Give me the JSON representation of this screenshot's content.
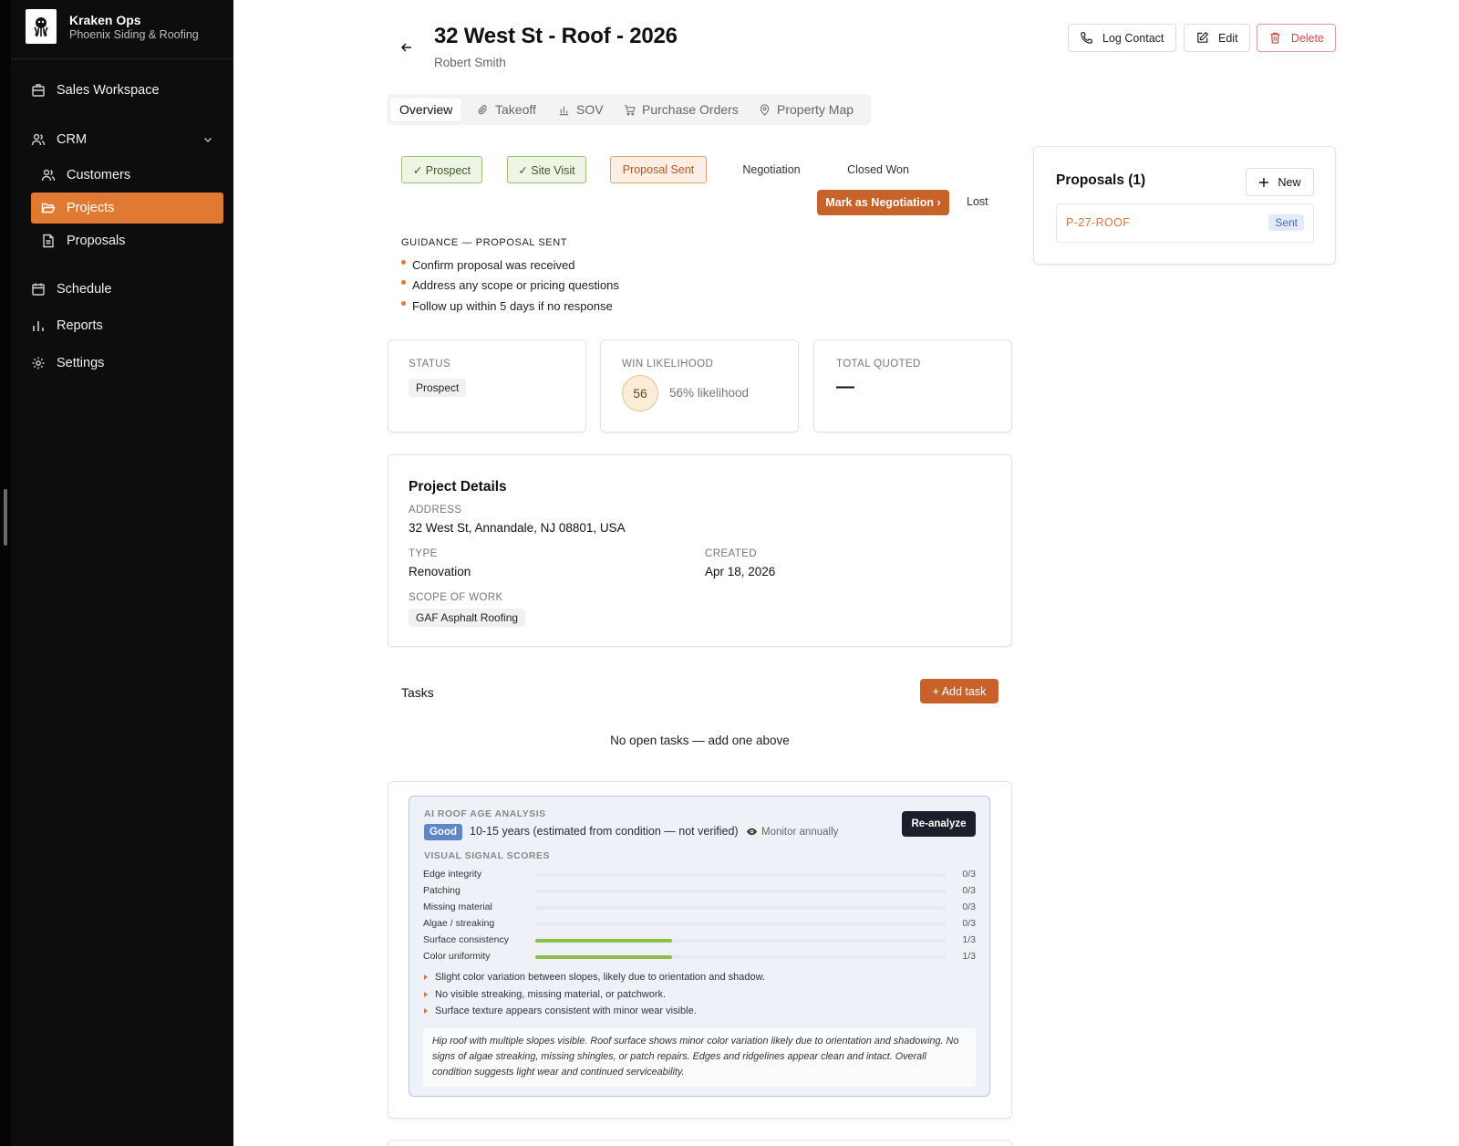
{
  "brand": {
    "name": "Kraken Ops",
    "subtitle": "Phoenix Siding & Roofing"
  },
  "sidebar": {
    "items": [
      {
        "label": "Sales Workspace",
        "icon": "building-icon"
      },
      {
        "label": "CRM",
        "icon": "users-icon",
        "expanded": true
      },
      {
        "label": "Customers",
        "icon": "users-icon"
      },
      {
        "label": "Projects",
        "icon": "folder-open-icon",
        "active": true
      },
      {
        "label": "Proposals",
        "icon": "file-text-icon"
      },
      {
        "label": "Schedule",
        "icon": "calendar-icon"
      },
      {
        "label": "Reports",
        "icon": "bar-chart-icon"
      },
      {
        "label": "Settings",
        "icon": "gear-icon"
      }
    ]
  },
  "header": {
    "title": "32 West St - Roof - 2026",
    "subtitle": "Robert Smith",
    "actions": {
      "log": "Log Contact",
      "edit": "Edit",
      "delete": "Delete"
    }
  },
  "tabs": [
    {
      "label": "Overview"
    },
    {
      "label": "Takeoff"
    },
    {
      "label": "SOV"
    },
    {
      "label": "Purchase Orders"
    },
    {
      "label": "Property Map"
    }
  ],
  "pipeline": {
    "stages": [
      "✓ Prospect",
      "✓ Site Visit",
      "Proposal Sent",
      "Negotiation",
      "Closed Won"
    ],
    "advance": "Mark as Negotiation ›",
    "lost": "Lost"
  },
  "guidance": {
    "title": "GUIDANCE — PROPOSAL SENT",
    "items": [
      "Confirm proposal was received",
      "Address any scope or pricing questions",
      "Follow up within 5 days if no response"
    ]
  },
  "stats": {
    "status_label": "STATUS",
    "status_value": "Prospect",
    "win_label": "WIN LIKELIHOOD",
    "win_score": "56",
    "win_text": "56% likelihood",
    "quoted_label": "TOTAL QUOTED",
    "quoted_value": "—"
  },
  "details": {
    "title": "Project Details",
    "address_label": "ADDRESS",
    "address": "32 West St, Annandale, NJ 08801, USA",
    "type_label": "TYPE",
    "type": "Renovation",
    "created_label": "CREATED",
    "created": "Apr 18, 2026",
    "scope_label": "SCOPE OF WORK",
    "scope": "GAF Asphalt Roofing"
  },
  "tasks": {
    "title": "Tasks",
    "add": "+ Add task",
    "empty": "No open tasks — add one above"
  },
  "ai": {
    "label": "AI ROOF AGE ANALYSIS",
    "rating": "Good",
    "age": "10-15 years (estimated from condition — not verified)",
    "monitor": "Monitor annually",
    "reanalyze": "Re-analyze",
    "signals_label": "VISUAL SIGNAL SCORES",
    "signals": [
      {
        "name": "Edge integrity",
        "score": "0/3",
        "value": 0
      },
      {
        "name": "Patching",
        "score": "0/3",
        "value": 0
      },
      {
        "name": "Missing material",
        "score": "0/3",
        "value": 0
      },
      {
        "name": "Algae / streaking",
        "score": "0/3",
        "value": 0
      },
      {
        "name": "Surface consistency",
        "score": "1/3",
        "value": 0.333
      },
      {
        "name": "Color uniformity",
        "score": "1/3",
        "value": 0.333
      }
    ],
    "bullets": [
      "Slight color variation between slopes, likely due to orientation and shadow.",
      "No visible streaking, missing material, or patchwork.",
      "Surface texture appears consistent with minor wear visible."
    ],
    "summary": "Hip roof with multiple slopes visible. Roof surface shows minor color variation likely due to orientation and shadowing. No signs of algae streaking, missing shingles, or patch repairs. Edges and ridgelines appear clean and intact. Overall condition suggests light wear and continued serviceability."
  },
  "proposals": {
    "title": "Proposals (1)",
    "new": "New",
    "items": [
      {
        "id": "P-27-ROOF",
        "status": "Sent"
      }
    ]
  },
  "colors": {
    "accent": "#e07a32",
    "accent_dark": "#c8612a",
    "sidebar": "#0d0d0d"
  }
}
